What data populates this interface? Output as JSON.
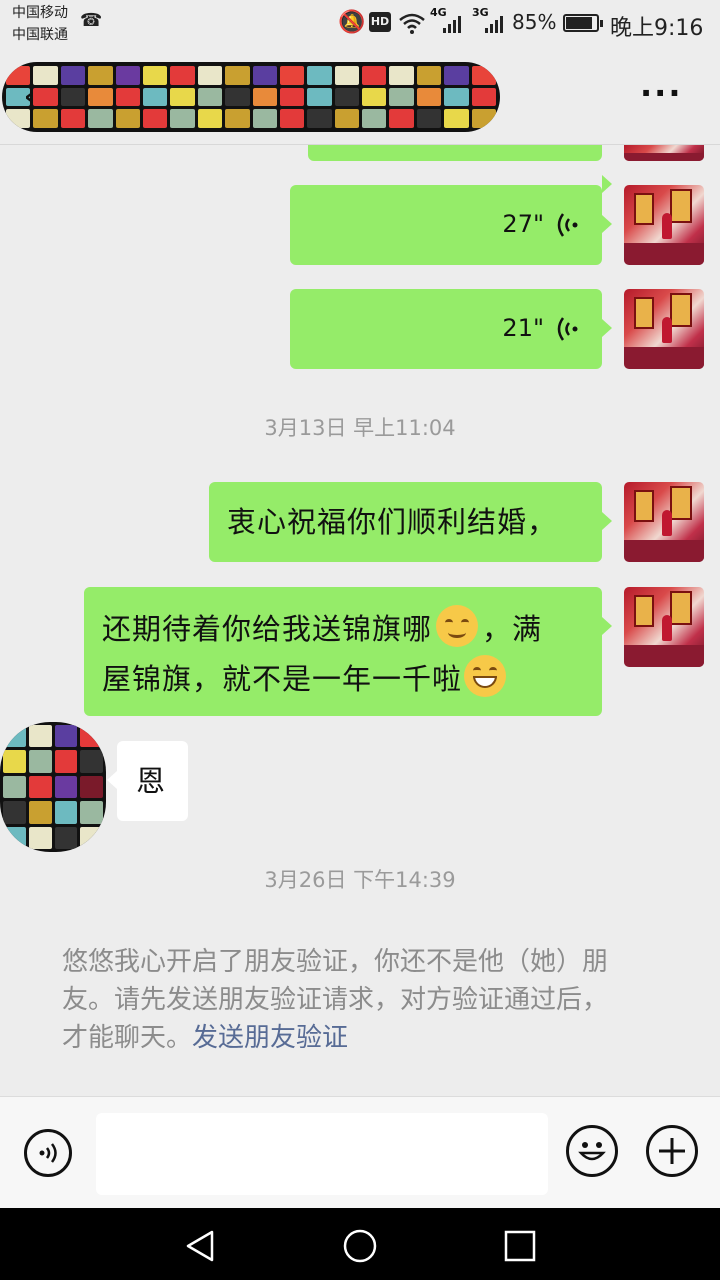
{
  "status_bar": {
    "carrier1": "中国移动",
    "carrier2": "中国联通",
    "network1": "4G",
    "network2": "3G",
    "battery": "85%",
    "time": "晚上9:16",
    "hd": "HD"
  },
  "header": {
    "back_icon": "back-arrow-icon",
    "more": "···"
  },
  "messages": {
    "voice1": {
      "duration": "27\""
    },
    "voice2": {
      "duration": "21\""
    },
    "ts1": "3月13日 早上11:04",
    "out1": "衷心祝福你们顺利结婚，",
    "out2_line1": "还期待着你给我送锦旗哪",
    "out2_line1b": "，满",
    "out2_line2": "屋锦旗，就不是一年一千啦",
    "in1": "恩",
    "ts2": "3月26日 下午14:39",
    "system_line1": "悠悠我心开启了朋友验证，你还不是他（她）朋",
    "system_line2": "友。请先发送朋友验证请求，对方验证通过后，",
    "system_line3": "才能聊天。",
    "system_link": "发送朋友验证"
  },
  "input_bar": {
    "voice_icon": "voice-mode-icon",
    "emoji_icon": "emoji-icon",
    "plus_icon": "plus-icon",
    "text_value": ""
  },
  "colors": {
    "outgoing_bubble": "#95ec69",
    "incoming_bubble": "#ffffff",
    "background": "#ededed",
    "link": "#576b95"
  }
}
